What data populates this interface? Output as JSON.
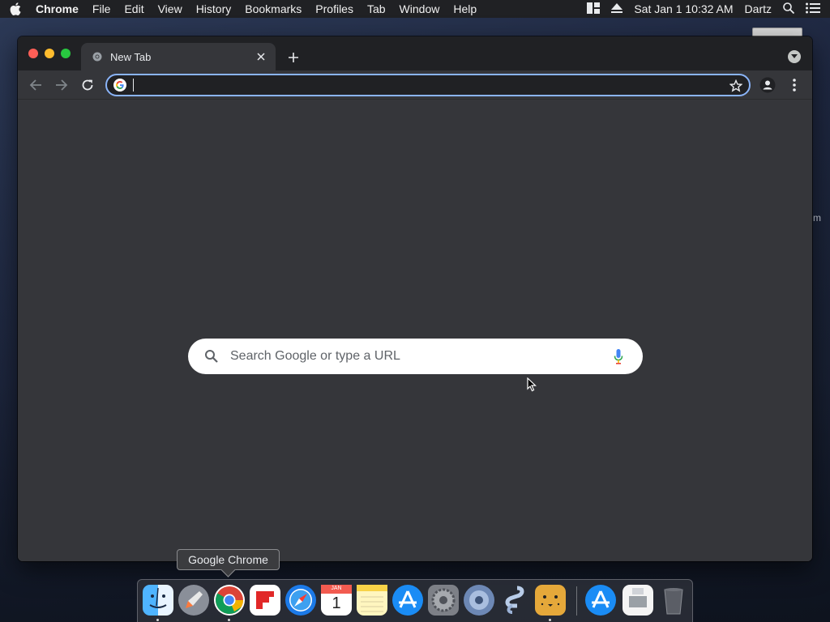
{
  "menubar": {
    "apple_icon": "apple-icon",
    "app_name": "Chrome",
    "items": [
      "File",
      "Edit",
      "View",
      "History",
      "Bookmarks",
      "Profiles",
      "Tab",
      "Window",
      "Help"
    ],
    "status": {
      "datetime": "Sat Jan 1  10:32 AM",
      "user": "Dartz"
    }
  },
  "desktop": {
    "side_text": "m"
  },
  "browser": {
    "tab_title": "New Tab",
    "omnibox_value": "",
    "search_placeholder": "Search Google or type a URL"
  },
  "tooltip": {
    "text": "Google Chrome"
  },
  "dock": {
    "apps": [
      "finder",
      "launchpad",
      "google-chrome",
      "flipboard",
      "safari",
      "calendar",
      "notes",
      "app-store",
      "system-preferences",
      "utility",
      "script-editor",
      "cheetah",
      "app-store",
      "preview",
      "trash"
    ],
    "calendar": {
      "month": "JAN",
      "day": "1"
    }
  },
  "colors": {
    "accent": "#8ab4f8",
    "window_bg": "#35363a",
    "tabstrip_bg": "#202124"
  }
}
